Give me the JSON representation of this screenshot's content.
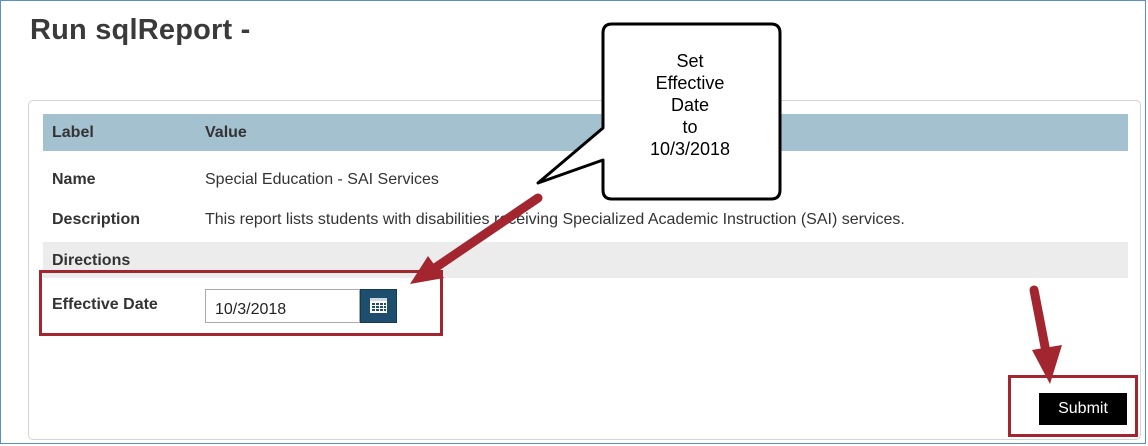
{
  "page": {
    "title": "Run sqlReport -"
  },
  "table": {
    "header": {
      "label": "Label",
      "value": "Value"
    },
    "name": {
      "label": "Name",
      "value": "Special Education - SAI Services"
    },
    "description": {
      "label": "Description",
      "value": "This report lists students with disabilities receiving Specialized Academic Instruction (SAI) services."
    },
    "directions": {
      "label": "Directions"
    }
  },
  "effective_date": {
    "label": "Effective Date",
    "value": "10/3/2018",
    "calendar_icon": "calendar-icon"
  },
  "actions": {
    "submit_label": "Submit"
  },
  "callout": {
    "lines": [
      "Set",
      "Effective",
      "Date",
      "to",
      "10/3/2018"
    ]
  },
  "colors": {
    "accent": "#a32530",
    "header_bg": "#a4c1d0",
    "calendar_btn": "#1e4e6e"
  }
}
